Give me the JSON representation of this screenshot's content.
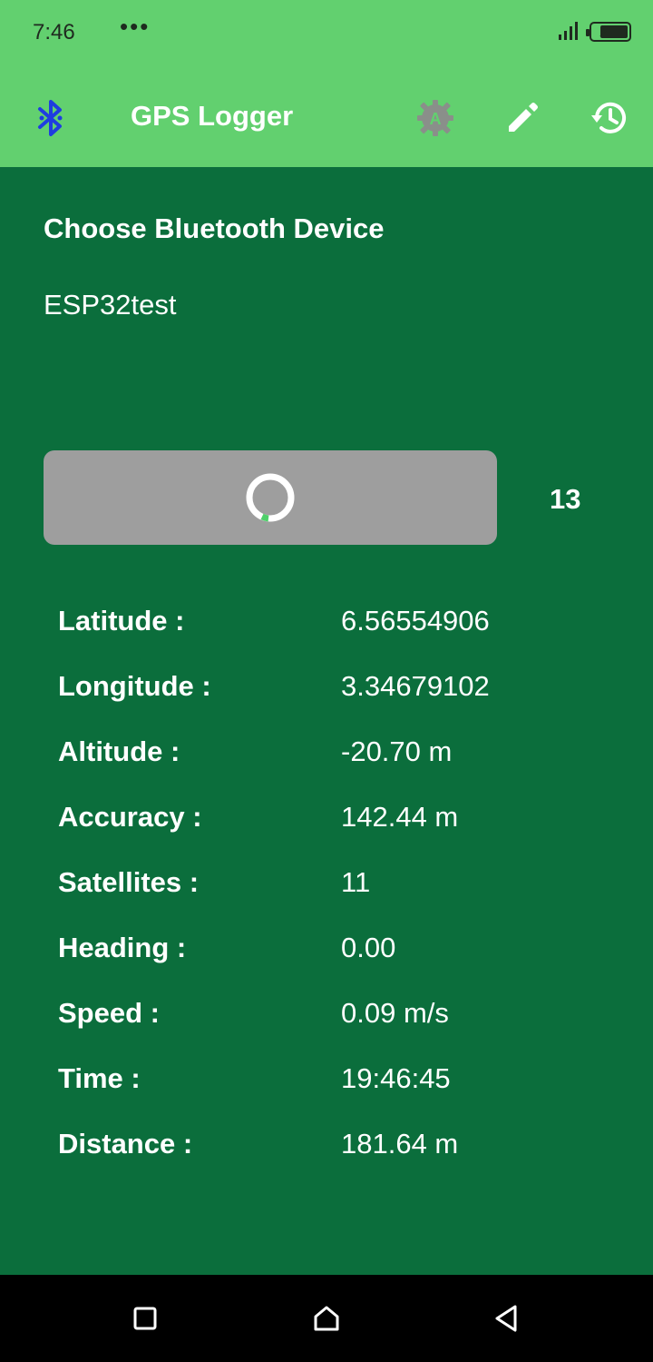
{
  "status_bar": {
    "time": "7:46",
    "more": "•••",
    "signal_icon": "signal-icon",
    "battery_icon": "battery-charging-icon",
    "battery_level": 0.8
  },
  "app_bar": {
    "title": "GPS Logger",
    "bluetooth_icon": "bluetooth-icon",
    "settings_icon": "auto-settings-icon",
    "edit_icon": "pencil-icon",
    "history_icon": "history-icon"
  },
  "device": {
    "section_title": "Choose Bluetooth Device",
    "name": "ESP32test"
  },
  "connect": {
    "spinner_icon": "loading-spinner-icon",
    "count": "13"
  },
  "readings": [
    {
      "label": "Latitude :",
      "value": "6.56554906"
    },
    {
      "label": "Longitude :",
      "value": "3.34679102"
    },
    {
      "label": "Altitude :",
      "value": "-20.70 m"
    },
    {
      "label": "Accuracy :",
      "value": "142.44 m"
    },
    {
      "label": "Satellites :",
      "value": "11"
    },
    {
      "label": "Heading :",
      "value": "0.00"
    },
    {
      "label": "Speed :",
      "value": "0.09 m/s"
    },
    {
      "label": "Time :",
      "value": "19:46:45"
    },
    {
      "label": "Distance :",
      "value": "181.64 m"
    }
  ],
  "nav_bar": {
    "recents_icon": "square-icon",
    "home_icon": "home-icon",
    "back_icon": "back-triangle-icon"
  },
  "colors": {
    "app_bar": "#62d06f",
    "background": "#0b6e3c",
    "button": "#9e9e9e",
    "bluetooth": "#1f3de0",
    "spinner_accent": "#4fd06a"
  }
}
